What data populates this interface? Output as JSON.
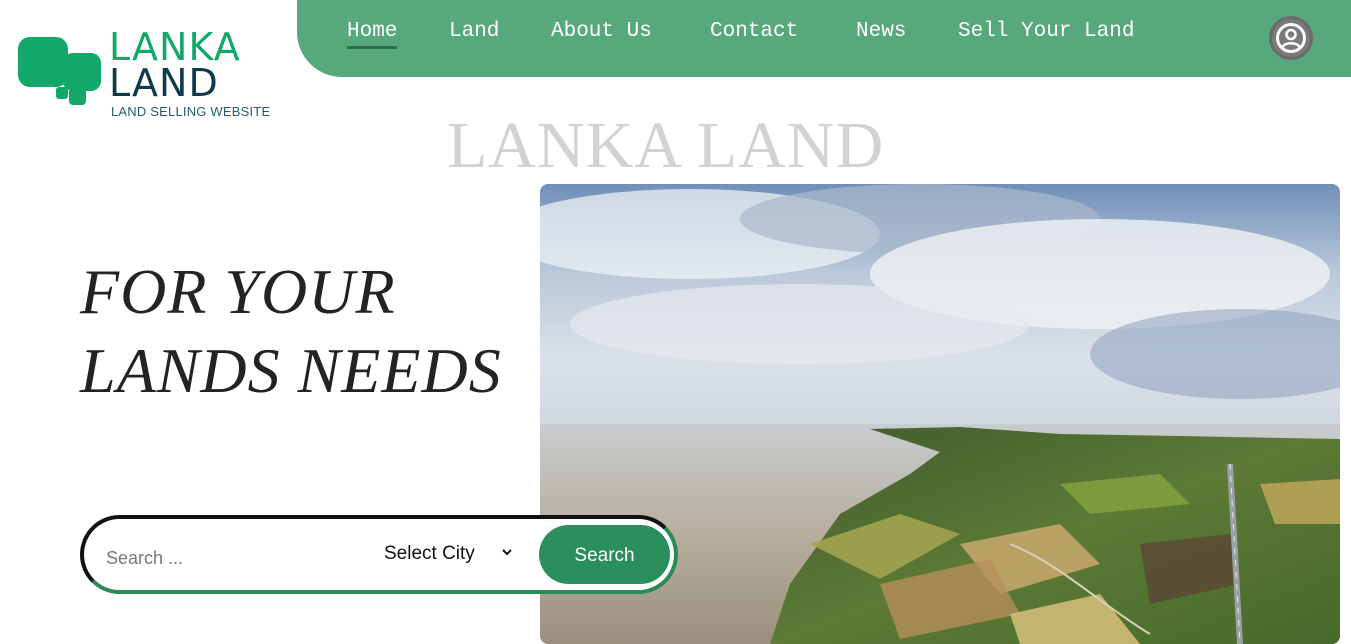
{
  "brand": {
    "name_line_1": "LANKA",
    "name_line_2": "LAND",
    "tagline": "LAND SELLING WEBSITE",
    "primary_color": "#11a86a",
    "secondary_color": "#0d3b4c"
  },
  "nav": {
    "background_color": "#57a97c",
    "items": [
      {
        "label": "Home",
        "active": true
      },
      {
        "label": "Land",
        "active": false
      },
      {
        "label": "About Us",
        "active": false
      },
      {
        "label": "Contact",
        "active": false
      },
      {
        "label": "News",
        "active": false
      },
      {
        "label": "Sell Your Land",
        "active": false
      }
    ],
    "user_icon": "user-circle-icon"
  },
  "hero": {
    "watermark": "LANKA LAND",
    "heading_line_1": "FOR YOUR",
    "heading_line_2": "LANDS NEEDS",
    "image_subject": "aerial coastline landscape"
  },
  "search": {
    "placeholder": "Search ...",
    "value": "",
    "city_select_value": "Select City",
    "button_label": "Search",
    "button_color": "#2a8f5c"
  }
}
